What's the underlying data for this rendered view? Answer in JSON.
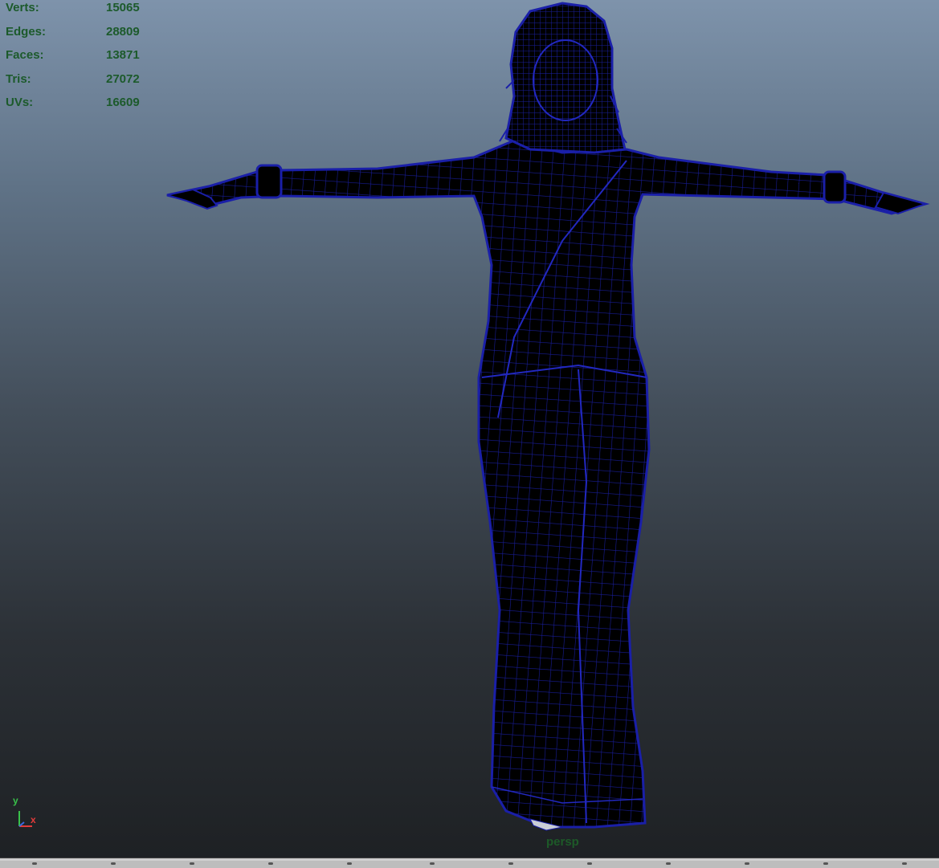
{
  "hud": {
    "stats": [
      {
        "label": "Verts:",
        "value": "15065"
      },
      {
        "label": "Edges:",
        "value": "28809"
      },
      {
        "label": "Faces:",
        "value": "13871"
      },
      {
        "label": "Tris:",
        "value": "27072"
      },
      {
        "label": "UVs:",
        "value": "16609"
      }
    ]
  },
  "viewport": {
    "camera": "persp",
    "shading": "wireframe-on-shaded",
    "model_icon": "female-figure-saree-mesh"
  },
  "axis_gizmo": {
    "y": "y",
    "x": "x",
    "colors": {
      "y": "#39c14a",
      "x": "#e23b3b",
      "z": "#3b6ae2"
    }
  },
  "colors": {
    "hud_text": "#1c5a2b",
    "wireframe": "#1a1fa8",
    "model_fill": "#000000"
  }
}
